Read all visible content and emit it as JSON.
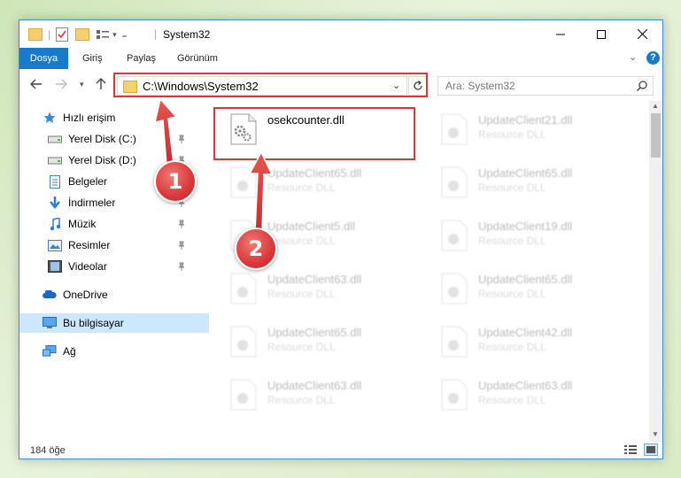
{
  "window": {
    "title": "System32",
    "title_separator": "|"
  },
  "ribbon": {
    "tabs": [
      {
        "label": "Dosya",
        "active": true
      },
      {
        "label": "Giriş",
        "active": false
      },
      {
        "label": "Paylaş",
        "active": false
      },
      {
        "label": "Görünüm",
        "active": false
      }
    ]
  },
  "address": {
    "path": "C:\\Windows\\System32",
    "search_placeholder": "Ara: System32"
  },
  "nav": {
    "items": [
      {
        "label": "Hızlı erişim",
        "icon": "star-icon",
        "pinned": false,
        "selected": false
      },
      {
        "label": "Yerel Disk (C:)",
        "icon": "drive-icon",
        "pinned": true,
        "selected": false
      },
      {
        "label": "Yerel Disk (D:)",
        "icon": "drive-icon",
        "pinned": true,
        "selected": false
      },
      {
        "label": "Belgeler",
        "icon": "documents-icon",
        "pinned": true,
        "selected": false
      },
      {
        "label": "İndirmeler",
        "icon": "download-icon",
        "pinned": true,
        "selected": false
      },
      {
        "label": "Müzik",
        "icon": "music-icon",
        "pinned": true,
        "selected": false
      },
      {
        "label": "Resimler",
        "icon": "pictures-icon",
        "pinned": true,
        "selected": false
      },
      {
        "label": "Videolar",
        "icon": "videos-icon",
        "pinned": true,
        "selected": false
      },
      {
        "label": "OneDrive",
        "icon": "cloud-icon",
        "pinned": false,
        "selected": false
      },
      {
        "label": "Bu bilgisayar",
        "icon": "computer-icon",
        "pinned": false,
        "selected": true
      },
      {
        "label": "Ağ",
        "icon": "network-icon",
        "pinned": false,
        "selected": false
      }
    ]
  },
  "files": [
    {
      "name": "osekcounter.dll",
      "type": ""
    },
    {
      "name": "UpdateClient21.dll",
      "type": "Resource DLL"
    },
    {
      "name": "UpdateClient65.dll",
      "type": "Resource DLL"
    },
    {
      "name": "UpdateClient65.dll",
      "type": "Resource DLL"
    },
    {
      "name": "UpdateClient5.dll",
      "type": "Resource DLL"
    },
    {
      "name": "UpdateClient19.dll",
      "type": "Resource DLL"
    },
    {
      "name": "UpdateClient63.dll",
      "type": "Resource DLL"
    },
    {
      "name": "UpdateClient65.dll",
      "type": "Resource DLL"
    },
    {
      "name": "UpdateClient65.dll",
      "type": "Resource DLL"
    },
    {
      "name": "UpdateClient42.dll",
      "type": "Resource DLL"
    },
    {
      "name": "UpdateClient63.dll",
      "type": "Resource DLL"
    },
    {
      "name": "UpdateClient63.dll",
      "type": "Resource DLL"
    }
  ],
  "status": {
    "item_count": "184 öğe"
  },
  "annotations": {
    "badge_1": "1",
    "badge_2": "2",
    "accent_color": "#d9383b"
  }
}
